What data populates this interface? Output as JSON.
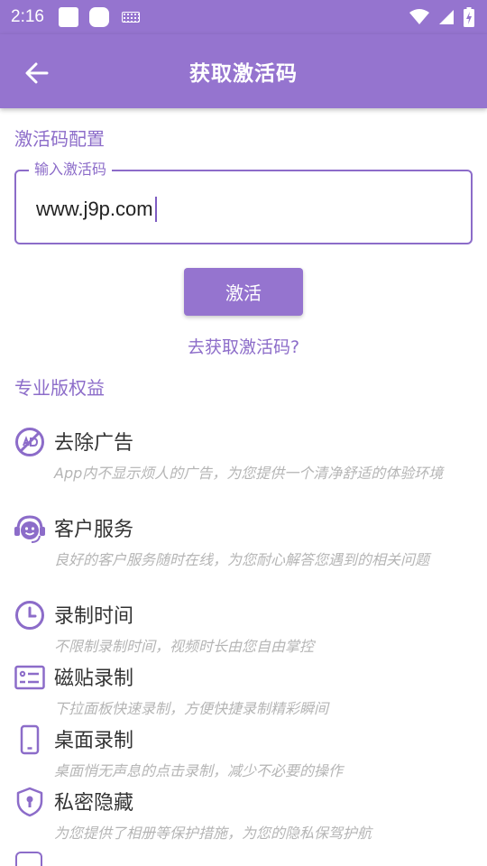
{
  "status_bar": {
    "time": "2:16"
  },
  "app_bar": {
    "title": "获取激活码"
  },
  "config_section": {
    "title": "激活码配置"
  },
  "code_input": {
    "label": "输入激活码",
    "value": "www.j9p.com"
  },
  "activate_button": {
    "label": "激活"
  },
  "get_code_link": {
    "label": "去获取激活码?"
  },
  "pro_section": {
    "title": "专业版权益"
  },
  "features": [
    {
      "icon": "no-ads-icon",
      "title": "去除广告",
      "desc": "App内不显示烦人的广告，为您提供一个清净舒适的体验环境"
    },
    {
      "icon": "headset-support-icon",
      "title": "客户服务",
      "desc": "良好的客户服务随时在线，为您耐心解答您遇到的相关问题"
    },
    {
      "icon": "clock-icon",
      "title": "录制时间",
      "desc": "不限制录制时间，视频时长由您自由掌控"
    },
    {
      "icon": "tile-card-icon",
      "title": "磁贴录制",
      "desc": "下拉面板快速录制，方便快捷录制精彩瞬间"
    },
    {
      "icon": "phone-icon",
      "title": "桌面录制",
      "desc": "桌面悄无声息的点击录制，减少不必要的操作"
    },
    {
      "icon": "shield-lock-icon",
      "title": "私密隐藏",
      "desc": "为您提供了相册等保护措施，为您的隐私保驾护航"
    }
  ],
  "colors": {
    "primary": "#9574cf",
    "accent_text": "#8c6cc9",
    "desc_text": "#b5b5b5"
  }
}
